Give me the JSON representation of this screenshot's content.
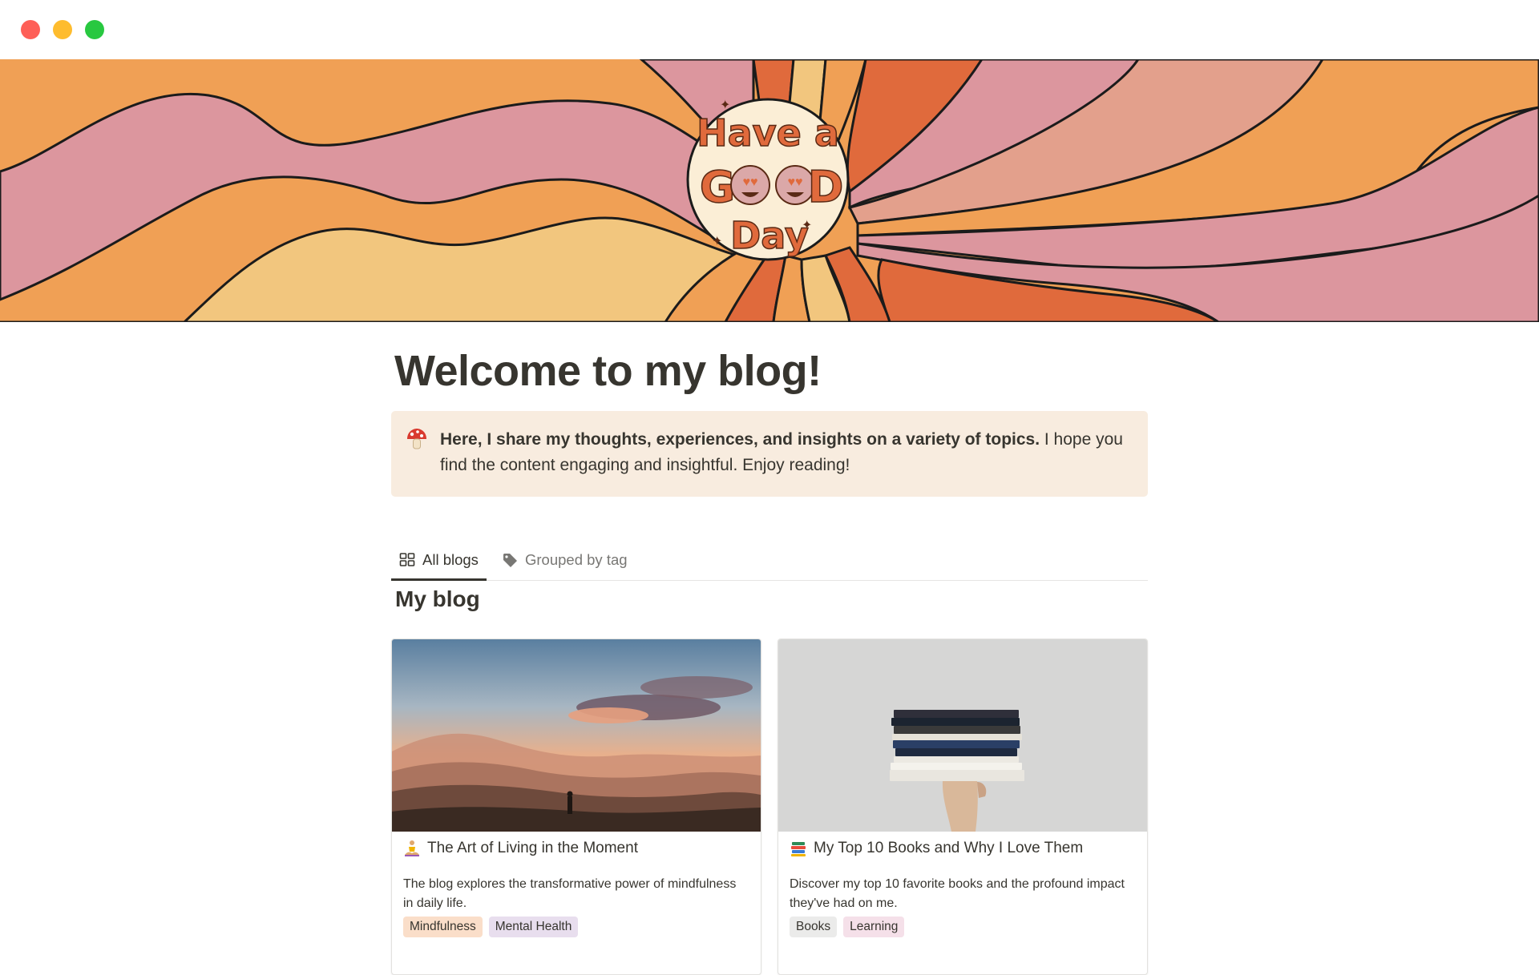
{
  "window": {
    "controls": [
      "close",
      "minimize",
      "maximize"
    ]
  },
  "cover": {
    "sticker_text": "Have a Good Day",
    "colors": {
      "orange": "#f0a055",
      "pink": "#dc969e",
      "yellow": "#f2c67e",
      "burnt": "#e06a3c",
      "sticker": "#fbeed6"
    }
  },
  "page": {
    "title": "Welcome to my blog!",
    "callout": {
      "icon": "mushroom-icon",
      "bold_text": "Here, I share my thoughts, experiences, and insights on a variety of topics.",
      "text": " I hope you find the content engaging and insightful. Enjoy reading!"
    },
    "tabs": [
      {
        "label": "All blogs",
        "icon": "gallery-grid-icon",
        "active": true
      },
      {
        "label": "Grouped by tag",
        "icon": "tag-icon",
        "active": false
      }
    ],
    "section_title": "My blog",
    "cards": [
      {
        "emoji": "meditation-icon",
        "title": "The Art of Living in the Moment",
        "description": "The blog explores the transformative power of mindfulness in daily life.",
        "tags": [
          {
            "label": "Mindfulness",
            "color": "#fadec9"
          },
          {
            "label": "Mental Health",
            "color": "#e8deee"
          }
        ],
        "image": "mountain-sunset-image"
      },
      {
        "emoji": "books-icon",
        "title": "My Top 10 Books and Why I Love Them",
        "description": "Discover my top 10 favorite books and the profound impact they've had on me.",
        "tags": [
          {
            "label": "Books",
            "color": "#ebebea"
          },
          {
            "label": "Learning",
            "color": "#f5e0e9"
          }
        ],
        "image": "book-stack-image"
      }
    ]
  }
}
